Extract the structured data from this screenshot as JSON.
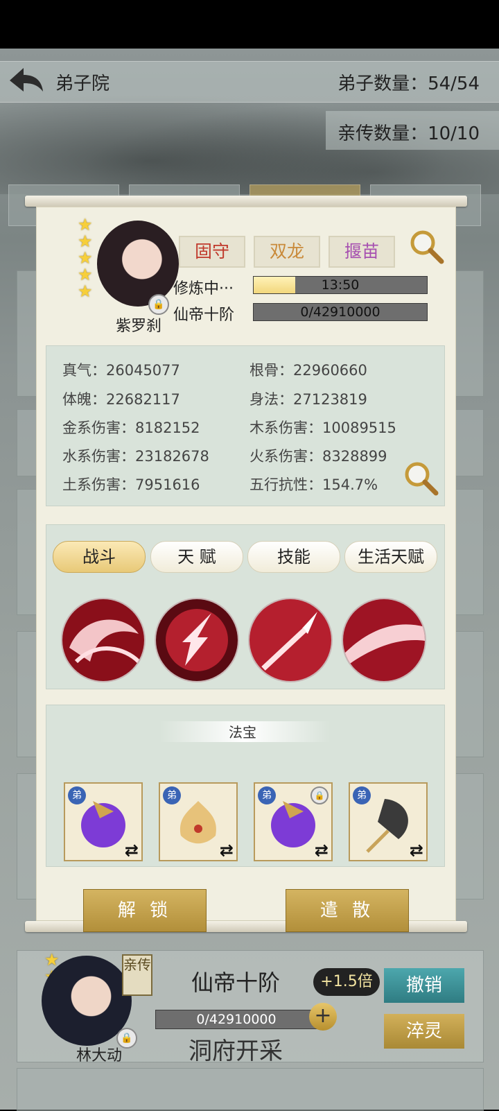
{
  "header": {
    "back_icon": "back-arrow-icon",
    "title": "弟子院",
    "disciple_count": "弟子数量：54/54",
    "personal_count": "亲传数量：10/10"
  },
  "disciple": {
    "name": "紫罗刹",
    "stars": 5,
    "tags": [
      {
        "label": "固守",
        "color": "#c0392b"
      },
      {
        "label": "双龙",
        "color": "#c98a3a"
      },
      {
        "label": "揠苗",
        "color": "#a64fb0"
      }
    ],
    "training_label": "修炼中···",
    "training_time": "13:50",
    "training_progress": 0.24,
    "realm_label": "仙帝十阶",
    "realm_progress_text": "0/42910000"
  },
  "stats": [
    "真气：26045077",
    "根骨：22960660",
    "体魄：22682117",
    "身法：27123819",
    "金系伤害：8182152",
    "木系伤害：10089515",
    "水系伤害：23182678",
    "火系伤害：8328899",
    "土系伤害：7951616",
    "五行抗性：154.7%"
  ],
  "tabs": [
    "战斗",
    "天 赋",
    "技能",
    "生活天赋"
  ],
  "skills": [
    "crimson-swirl-icon",
    "lightning-arrow-icon",
    "spear-thrust-icon",
    "blood-slash-icon"
  ],
  "treasures": {
    "title": "法宝",
    "badge": "弟",
    "swap_glyph": "⇄",
    "items": [
      {
        "icon": "purple-orb-treasure-icon",
        "locked": false
      },
      {
        "icon": "golden-lotus-treasure-icon",
        "locked": false
      },
      {
        "icon": "purple-orb-treasure-icon",
        "locked": true
      },
      {
        "icon": "feather-fan-treasure-icon",
        "locked": false
      }
    ]
  },
  "buttons": {
    "unlock": "解 锁",
    "dismiss": "遣 散"
  },
  "next_disciple": {
    "badge": "亲传",
    "rank": "仙帝十阶",
    "multiplier": "+1.5倍",
    "progress_text": "0/42910000",
    "location": "洞府开采",
    "name": "林大动",
    "revoke": "撤销",
    "refine": "淬灵"
  },
  "colors": {
    "panel": "#f1efe1",
    "stat_box": "#d9e3da",
    "gold_button": "#c6a24d",
    "teal_button": "#3f8f95"
  }
}
